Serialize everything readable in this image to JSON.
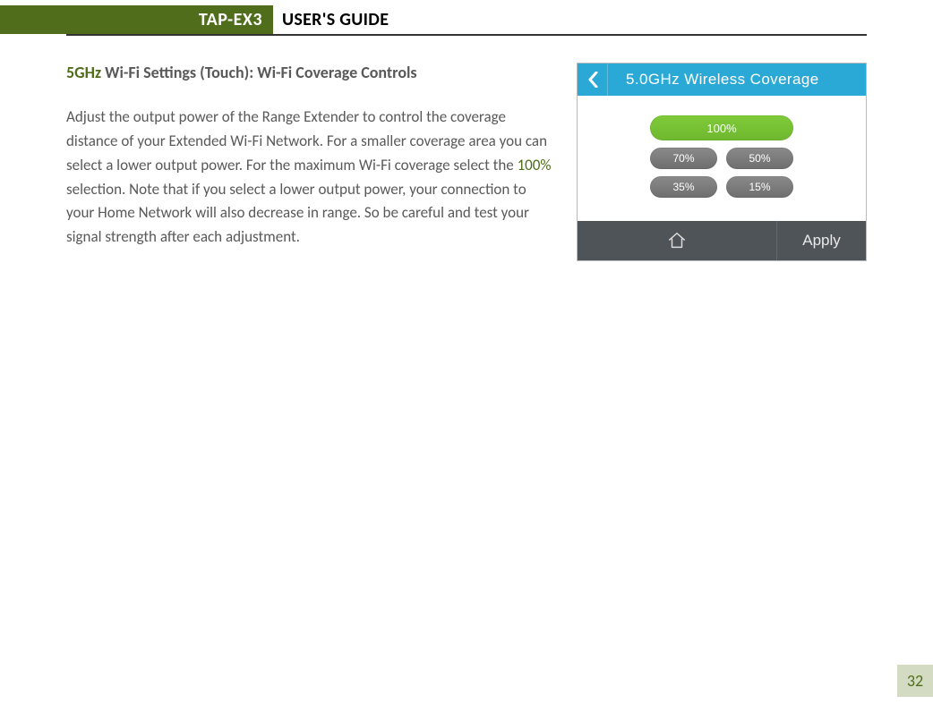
{
  "header": {
    "badge": "TAP-EX3",
    "title": "USER'S GUIDE"
  },
  "section": {
    "title_prefix": "5GHz",
    "title_rest": " Wi-Fi Settings (Touch): Wi-Fi Coverage Controls"
  },
  "body": {
    "p1a": "Adjust the output power of the Range Extender to control the coverage distance of your Extended Wi-Fi Network. For a smaller coverage area you can select a lower output power. For the maximum Wi-Fi coverage select the ",
    "p1_green": "100%",
    "p1b": " selection. Note that if you select a lower output power, your connection to your Home Network will also decrease in range. So be careful and test your signal strength after each adjustment."
  },
  "screenshot": {
    "title": "5.0GHz Wireless Coverage",
    "options": {
      "selected": "100%",
      "row1": [
        "70%",
        "50%"
      ],
      "row2": [
        "35%",
        "15%"
      ]
    },
    "apply": "Apply"
  },
  "page_number": "32"
}
